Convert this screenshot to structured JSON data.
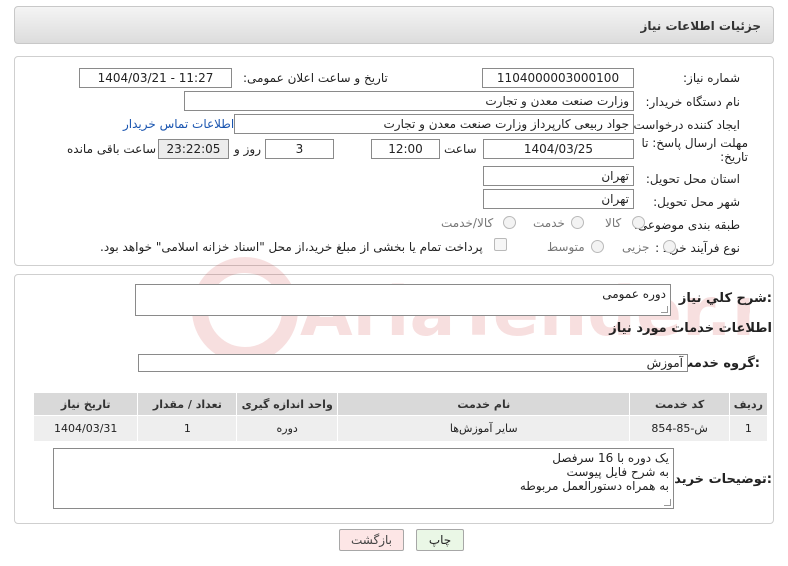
{
  "header": {
    "title": "جزئیات اطلاعات نیاز"
  },
  "need_info": {
    "need_number_label": "شماره نیاز:",
    "need_number": "1104000003000100",
    "announce_label": "تاریخ و ساعت اعلان عمومی:",
    "announce_value": "1404/03/21 - 11:27",
    "buyer_org_label": "نام دستگاه خریدار:",
    "buyer_org": "وزارت صنعت معدن و تجارت",
    "requester_label": "ایجاد کننده درخواست:",
    "requester": "جواد ربیعی کارپرداز وزارت صنعت معدن و تجارت",
    "contact_link": "اطلاعات تماس خریدار",
    "deadline_label": "مهلت ارسال پاسخ: تا تاریخ:",
    "deadline_date": "1404/03/25",
    "time_label": "ساعت",
    "deadline_time": "12:00",
    "days_value": "3",
    "days_label": "روز و",
    "remaining_value": "23:22:05",
    "remaining_label": "ساعت باقی مانده",
    "province_label": "استان محل تحویل:",
    "province": "تهران",
    "city_label": "شهر محل تحویل:",
    "city": "تهران",
    "category_label": "طبقه بندی موضوعی:",
    "category_options": [
      "کالا",
      "خدمت",
      "کالا/خدمت"
    ],
    "purchase_type_label": "نوع فرآیند خرید :",
    "purchase_type_options": [
      "جزیی",
      "متوسط"
    ],
    "treasury_note": "پرداخت تمام یا بخشی از مبلغ خرید،از محل \"اسناد خزانه اسلامی\" خواهد بود."
  },
  "description": {
    "summary_label": "شرح کلي نياز:",
    "summary_value": "دوره عمومی",
    "services_title": "اطلاعات خدمات مورد نياز",
    "service_group_label": "گروه خدمت:",
    "service_group_value": "آموزش"
  },
  "table": {
    "headers": [
      "ردیف",
      "کد خدمت",
      "نام خدمت",
      "واحد اندازه گیری",
      "تعداد / مقدار",
      "تاریخ نیاز"
    ],
    "rows": [
      [
        "1",
        "ش-85-854",
        "سایر آموزش‌ها",
        "دوره",
        "1",
        "1404/03/31"
      ]
    ]
  },
  "buyer_notes": {
    "label": "توضیحات خریدار:",
    "lines": [
      "یک دوره با 16 سرفصل",
      "به شرح فایل پیوست",
      "به همراه دستورالعمل مربوطه"
    ]
  },
  "buttons": {
    "print": "چاپ",
    "back": "بازگشت"
  },
  "watermark": {
    "text": "AriaTender.neT"
  },
  "colors": {
    "link": "#1a55b0",
    "back_button_bg": "#fde6e6",
    "print_button_bg": "#eaf7e6"
  }
}
